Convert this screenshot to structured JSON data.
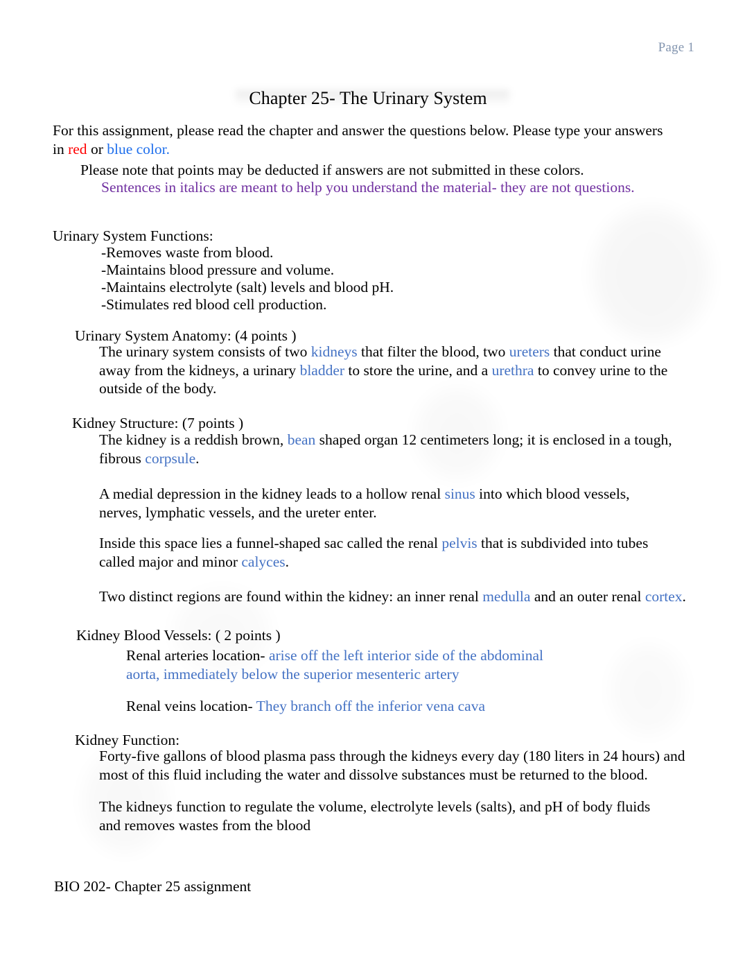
{
  "header": {
    "page_label": "Page 1",
    "page_label_color": "#8496B0"
  },
  "title": "Chapter 25- The Urinary System",
  "intro": {
    "line_part_1": "For this assignment, please read the chapter and answer the questions below. Please type your answers in ",
    "red_word": "red",
    "conjunction": " or ",
    "blue_words": "blue color.",
    "note_black": "Please note that points may be deducted if answers are not submitted in these colors.",
    "note_purple": "Sentences in italics are meant to help you understand the material- they are not questions.",
    "red_color": "#FF0000",
    "blue_color": "#1F6FEC",
    "purple_color": "#7030A0"
  },
  "sections": {
    "functions": {
      "heading": "Urinary System Functions:",
      "items": [
        "-Removes waste from blood.",
        "-Maintains blood pressure and volume.",
        "-Maintains electrolyte (salt) levels and blood pH.",
        "-Stimulates red blood cell production."
      ]
    },
    "anatomy": {
      "heading": "Urinary System Anatomy: (4 points )",
      "p1_a": "The urinary system consists of two ",
      "p1_term1": "kidneys",
      "p1_b": " that filter the blood, two ",
      "p1_term2": "ureters",
      "p1_c": " that conduct urine away from the kidneys, a urinary ",
      "p1_term3": "bladder",
      "p1_d": " to store the urine, and a ",
      "p1_term4": "urethra",
      "p1_e": " to convey urine to the outside of the body."
    },
    "kidney_structure": {
      "heading": "Kidney Structure: (7 points )",
      "p1_a": "The kidney is a reddish brown, ",
      "p1_term1": "bean",
      "p1_b": " shaped organ 12 centimeters long; it is enclosed in a tough, fibrous ",
      "p1_term2": "corpsule",
      "p1_c": ".",
      "p2_a": "A medial depression in the kidney leads to a hollow renal ",
      "p2_term1": "sinus",
      "p2_b": " into which blood vessels, nerves, lymphatic vessels, and the ureter enter.",
      "p3_a": "Inside this space lies a funnel-shaped sac called the renal ",
      "p3_term1": "pelvis",
      "p3_b": " that is subdivided into tubes called major and minor ",
      "p3_term2": "calyces",
      "p3_c": ".",
      "p4_a": "Two distinct regions are found within the kidney: an inner renal ",
      "p4_term1": "medulla",
      "p4_b": " and an outer renal ",
      "p4_term2": "cortex",
      "p4_c": ".",
      "term_color": "#4472C4"
    },
    "kidney_blood_vessels": {
      "heading": "Kidney Blood Vessels: ( 2 points )",
      "arteries_label": "Renal arteries location-",
      "arteries_answer": " arise off the left interior side of the abdominal aorta, immediately below the superior mesenteric artery",
      "veins_label": "Renal veins location-",
      "veins_answer": " They branch off the inferior vena cava",
      "answer_color": "#4472C4"
    },
    "kidney_function": {
      "heading": "Kidney Function:",
      "p1": "Forty-five gallons of blood plasma pass through the kidneys every day (180 liters in 24 hours) and most of this fluid including the water and dissolve substances must be returned to the blood.",
      "p2": "The kidneys function to regulate the volume, electrolyte levels (salts), and pH of body fluids and removes wastes from the blood"
    }
  },
  "footer": {
    "text": "BIO 202- Chapter 25 assignment"
  }
}
